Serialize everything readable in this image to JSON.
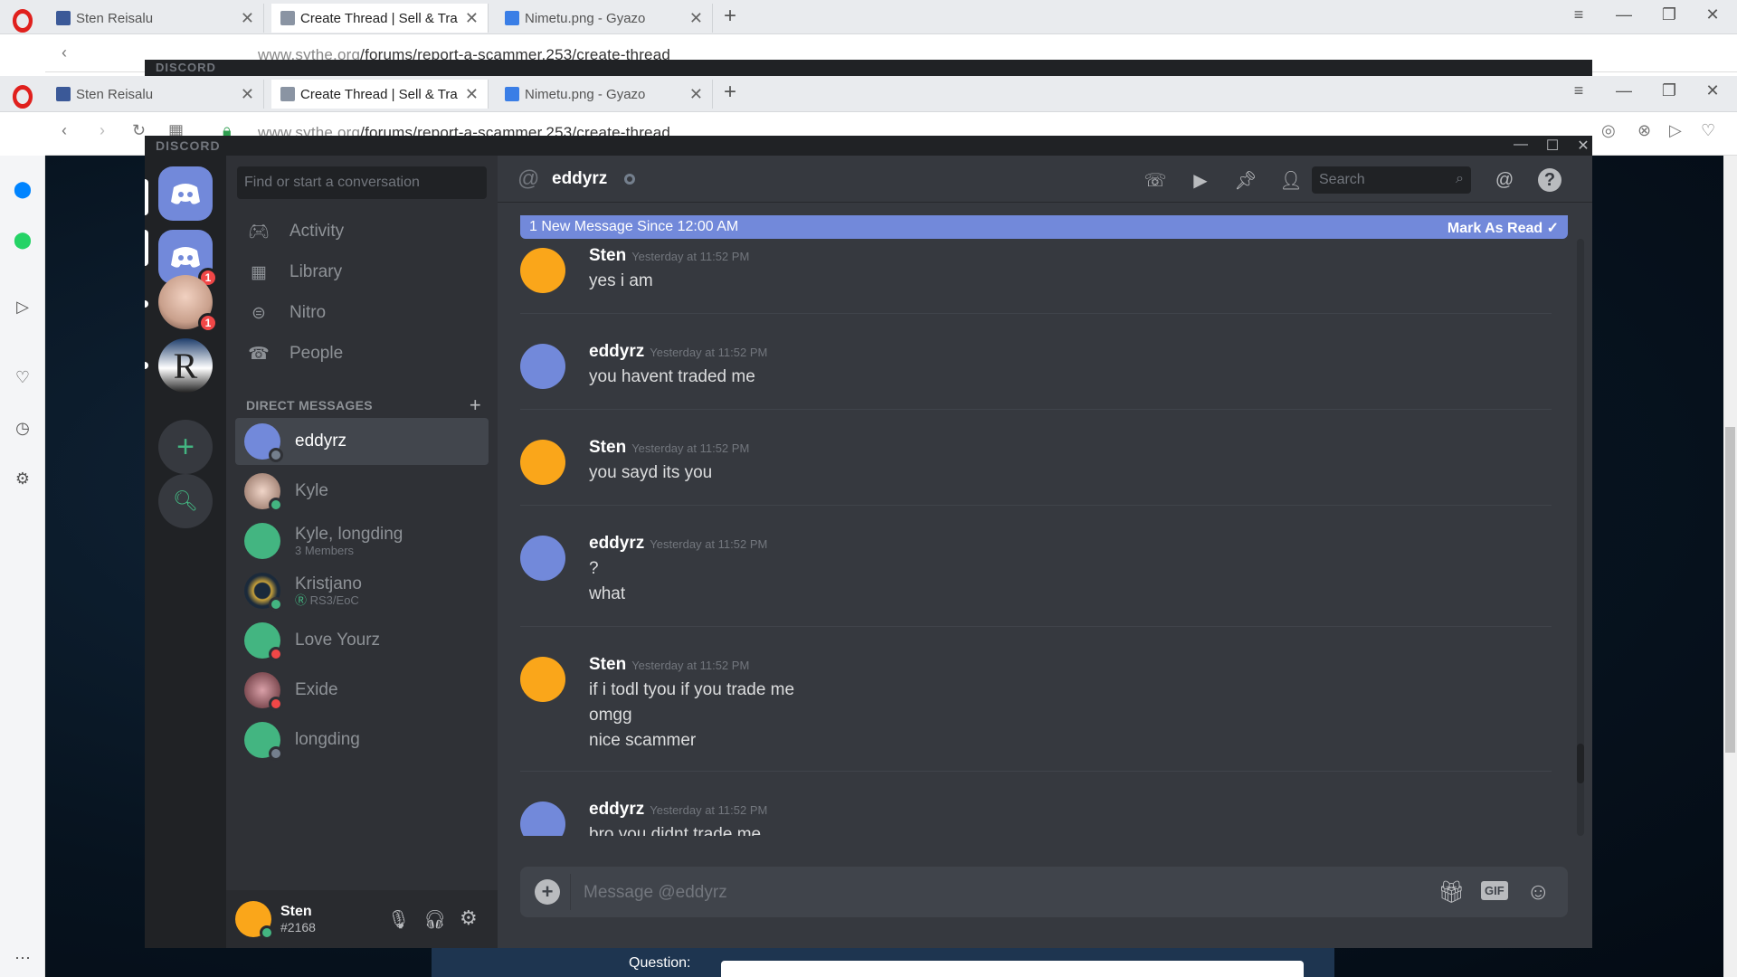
{
  "browser": {
    "tabs": [
      {
        "title": "Sten Reisalu",
        "favicon_color": "#3b5998"
      },
      {
        "title": "Create Thread | Sell & Trad",
        "favicon_color": "#8a94a3"
      },
      {
        "title": "Nimetu.png - Gyazo",
        "favicon_color": "#3a7ee6"
      }
    ],
    "url_host": "www.sythe.org",
    "url_path": "/forums/report-a-scammer.253/create-thread"
  },
  "discord": {
    "app_name": "DISCORD",
    "guild_badges": [
      "1",
      "1"
    ],
    "dm_search_placeholder": "Find or start a conversation",
    "nav": [
      {
        "label": "Activity",
        "icon": "gamepad-icon"
      },
      {
        "label": "Library",
        "icon": "library-icon"
      },
      {
        "label": "Nitro",
        "icon": "nitro-icon"
      },
      {
        "label": "People",
        "icon": "people-icon"
      }
    ],
    "dm_header": "DIRECT MESSAGES",
    "dms": [
      {
        "name": "eddyrz",
        "sub": "",
        "status": "offline"
      },
      {
        "name": "Kyle",
        "sub": "",
        "status": "online"
      },
      {
        "name": "Kyle, longding",
        "sub": "3 Members",
        "status": "none"
      },
      {
        "name": "Kristjano",
        "sub": "RS3/EoC",
        "status": "online"
      },
      {
        "name": "Love Yourz",
        "sub": "",
        "status": "dnd"
      },
      {
        "name": "Exide",
        "sub": "",
        "status": "dnd"
      },
      {
        "name": "longding",
        "sub": "",
        "status": "offline"
      }
    ],
    "user": {
      "name": "Sten",
      "tag": "#2168"
    },
    "channel": {
      "name": "eddyrz",
      "search_placeholder": "Search"
    },
    "new_message_bar": {
      "text": "1 New Message Since 12:00 AM",
      "action": "Mark As Read"
    },
    "messages": [
      {
        "author": "Sten",
        "time": "Yesterday at 11:52 PM",
        "lines": [
          "yes i am"
        ],
        "avatar_color": "#faa61a"
      },
      {
        "author": "eddyrz",
        "time": "Yesterday at 11:52 PM",
        "lines": [
          "you havent traded me"
        ],
        "avatar_color": "#7289da"
      },
      {
        "author": "Sten",
        "time": "Yesterday at 11:52 PM",
        "lines": [
          "you sayd its you"
        ],
        "avatar_color": "#faa61a"
      },
      {
        "author": "eddyrz",
        "time": "Yesterday at 11:52 PM",
        "lines": [
          "?",
          "what"
        ],
        "avatar_color": "#7289da"
      },
      {
        "author": "Sten",
        "time": "Yesterday at 11:52 PM",
        "lines": [
          "if i todl tyou if you trade me",
          "omgg",
          "nice scammer"
        ],
        "avatar_color": "#faa61a"
      },
      {
        "author": "eddyrz",
        "time": "Yesterday at 11:52 PM",
        "lines": [
          "bro you didnt trade me"
        ],
        "avatar_color": "#7289da"
      }
    ],
    "composer_placeholder": "Message @eddyrz",
    "gif_label": "GIF"
  },
  "page": {
    "question_label": "Question:"
  },
  "colors": {
    "blurple": "#7289da",
    "online": "#43b581",
    "dnd": "#f04747",
    "offline": "#747f8d"
  }
}
